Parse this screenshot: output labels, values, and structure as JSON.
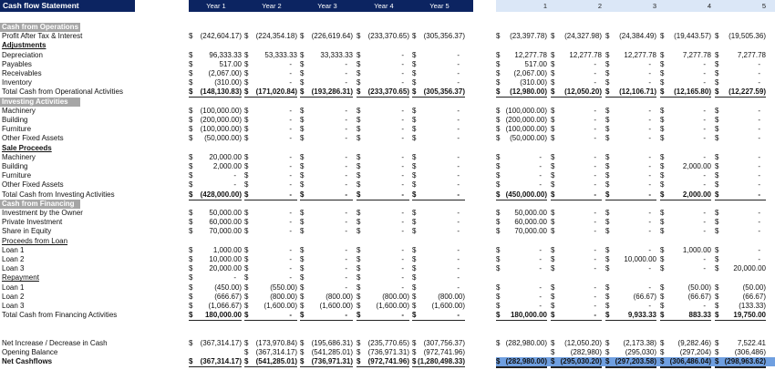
{
  "title": "Cash flow Statement",
  "year_headers": [
    "Year 1",
    "Year 2",
    "Year 3",
    "Year 4",
    "Year 5"
  ],
  "month_headers": [
    "1",
    "2",
    "3",
    "4",
    "5"
  ],
  "currency": "$",
  "colors": {
    "header_navy": "#0c2461",
    "month_header": "#dbe7f7",
    "section_gray": "#a6a6a6",
    "net_highlight": "#6f9fe0"
  },
  "rows": [
    {
      "label": "Cash from Operations",
      "type": "section"
    },
    {
      "label": "Profit After Tax & Interest",
      "type": "line",
      "years": [
        "(242,604.17)",
        "(224,354.18)",
        "(226,619.64)",
        "(233,370.65)",
        "(305,356.37)"
      ],
      "months": [
        "(23,397.78)",
        "(24,327.98)",
        "(24,384.49)",
        "(19,443.57)",
        "(19,505.36)"
      ]
    },
    {
      "label": "Adjustments",
      "type": "heading"
    },
    {
      "label": "Depreciation",
      "type": "line",
      "years": [
        "96,333.33",
        "53,333.33",
        "33,333.33",
        "-",
        "-"
      ],
      "months": [
        "12,277.78",
        "12,277.78",
        "12,277.78",
        "7,277.78",
        "7,277.78"
      ]
    },
    {
      "label": "Payables",
      "type": "line",
      "years": [
        "517.00",
        "-",
        "-",
        "-",
        "-"
      ],
      "months": [
        "517.00",
        "-",
        "-",
        "-",
        "-"
      ]
    },
    {
      "label": "Receivables",
      "type": "line",
      "years": [
        "(2,067.00)",
        "-",
        "-",
        "-",
        "-"
      ],
      "months": [
        "(2,067.00)",
        "-",
        "-",
        "-",
        "-"
      ]
    },
    {
      "label": "Inventory",
      "type": "line",
      "years": [
        "(310.00)",
        "-",
        "-",
        "-",
        "-"
      ],
      "months": [
        "(310.00)",
        "-",
        "-",
        "-",
        "-"
      ]
    },
    {
      "label": "Total Cash from Operational Activities",
      "type": "total",
      "years": [
        "(148,130.83)",
        "(171,020.84)",
        "(193,286.31)",
        "(233,370.65)",
        "(305,356.37)"
      ],
      "months": [
        "(12,980.00)",
        "(12,050.20)",
        "(12,106.71)",
        "(12,165.80)",
        "(12,227.59)"
      ]
    },
    {
      "label": "Investing Activities",
      "type": "section"
    },
    {
      "label": "Machinery",
      "type": "line",
      "years": [
        "(100,000.00)",
        "-",
        "-",
        "-",
        "-"
      ],
      "months": [
        "(100,000.00)",
        "-",
        "-",
        "-",
        "-"
      ]
    },
    {
      "label": "Building",
      "type": "line",
      "years": [
        "(200,000.00)",
        "-",
        "-",
        "-",
        "-"
      ],
      "months": [
        "(200,000.00)",
        "-",
        "-",
        "-",
        "-"
      ]
    },
    {
      "label": "Furniture",
      "type": "line",
      "years": [
        "(100,000.00)",
        "-",
        "-",
        "-",
        "-"
      ],
      "months": [
        "(100,000.00)",
        "-",
        "-",
        "-",
        "-"
      ]
    },
    {
      "label": "Other Fixed Assets",
      "type": "line",
      "years": [
        "(50,000.00)",
        "-",
        "-",
        "-",
        "-"
      ],
      "months": [
        "(50,000.00)",
        "-",
        "-",
        "-",
        "-"
      ]
    },
    {
      "label": "Sale Proceeds",
      "type": "heading"
    },
    {
      "label": "Machinery",
      "type": "line",
      "years": [
        "20,000.00",
        "-",
        "-",
        "-",
        "-"
      ],
      "months": [
        "-",
        "-",
        "-",
        "-",
        "-"
      ]
    },
    {
      "label": "Building",
      "type": "line",
      "years": [
        "2,000.00",
        "-",
        "-",
        "-",
        "-"
      ],
      "months": [
        "-",
        "-",
        "-",
        "2,000.00",
        "-"
      ]
    },
    {
      "label": "Furniture",
      "type": "line",
      "years": [
        "-",
        "-",
        "-",
        "-",
        "-"
      ],
      "months": [
        "-",
        "-",
        "-",
        "-",
        "-"
      ]
    },
    {
      "label": "Other Fixed Assets",
      "type": "line",
      "years": [
        "-",
        "-",
        "-",
        "-",
        "-"
      ],
      "months": [
        "-",
        "-",
        "-",
        "-",
        "-"
      ]
    },
    {
      "label": "Total Cash from Investing Activities",
      "type": "total",
      "years": [
        "(428,000.00)",
        "-",
        "-",
        "-",
        "-"
      ],
      "months": [
        "(450,000.00)",
        "-",
        "-",
        "2,000.00",
        "-"
      ]
    },
    {
      "label": "Cash from Financing",
      "type": "section"
    },
    {
      "label": "Investment by the Owner",
      "type": "line",
      "years": [
        "50,000.00",
        "-",
        "-",
        "-",
        "-"
      ],
      "months": [
        "50,000.00",
        "-",
        "-",
        "-",
        "-"
      ]
    },
    {
      "label": "Private Investment",
      "type": "line",
      "years": [
        "60,000.00",
        "-",
        "-",
        "-",
        "-"
      ],
      "months": [
        "60,000.00",
        "-",
        "-",
        "-",
        "-"
      ]
    },
    {
      "label": "Share in Equity",
      "type": "line",
      "years": [
        "70,000.00",
        "-",
        "-",
        "-",
        "-"
      ],
      "months": [
        "70,000.00",
        "-",
        "-",
        "-",
        "-"
      ]
    },
    {
      "label": "Proceeds from Loan",
      "type": "subheading"
    },
    {
      "label": "Loan 1",
      "type": "line",
      "years": [
        "1,000.00",
        "-",
        "-",
        "-",
        "-"
      ],
      "months": [
        "-",
        "-",
        "-",
        "1,000.00",
        "-"
      ]
    },
    {
      "label": "Loan 2",
      "type": "line",
      "years": [
        "10,000.00",
        "-",
        "-",
        "-",
        "-"
      ],
      "months": [
        "-",
        "-",
        "10,000.00",
        "-",
        "-"
      ]
    },
    {
      "label": "Loan 3",
      "type": "line",
      "years": [
        "20,000.00",
        "-",
        "-",
        "-",
        "-"
      ],
      "months": [
        "-",
        "-",
        "-",
        "-",
        "20,000.00"
      ]
    },
    {
      "label": "Repayment",
      "type": "subheading",
      "years": [
        "-",
        "-",
        "-",
        "-",
        "-"
      ]
    },
    {
      "label": "Loan 1",
      "type": "line",
      "years": [
        "(450.00)",
        "(550.00)",
        "-",
        "-",
        "-"
      ],
      "months": [
        "-",
        "-",
        "-",
        "(50.00)",
        "(50.00)"
      ]
    },
    {
      "label": "Loan 2",
      "type": "line",
      "years": [
        "(666.67)",
        "(800.00)",
        "(800.00)",
        "(800.00)",
        "(800.00)"
      ],
      "months": [
        "-",
        "-",
        "(66.67)",
        "(66.67)",
        "(66.67)"
      ]
    },
    {
      "label": "Loan 3",
      "type": "line",
      "years": [
        "(1,066.67)",
        "(1,600.00)",
        "(1,600.00)",
        "(1,600.00)",
        "(1,600.00)"
      ],
      "months": [
        "-",
        "-",
        "-",
        "-",
        "(133.33)"
      ]
    },
    {
      "label": "Total Cash from Financing Activities",
      "type": "total",
      "years": [
        "180,000.00",
        "-",
        "-",
        "-",
        "-"
      ],
      "months": [
        "180,000.00",
        "-",
        "9,933.33",
        "883.33",
        "19,750.00"
      ]
    },
    {
      "label": "",
      "type": "blank"
    },
    {
      "label": "",
      "type": "blank"
    },
    {
      "label": "Net Increase / Decrease in Cash",
      "type": "line",
      "years": [
        "(367,314.17)",
        "(173,970.84)",
        "(195,686.31)",
        "(235,770.65)",
        "(307,756.37)"
      ],
      "months": [
        "(282,980.00)",
        "(12,050.20)",
        "(2,173.38)",
        "(9,282.46)",
        "7,522.41"
      ]
    },
    {
      "label": "Opening Balance",
      "type": "line",
      "years": [
        null,
        "(367,314.17)",
        "(541,285.01)",
        "(736,971.31)",
        "(972,741.96)"
      ],
      "months": [
        null,
        "(282,980)",
        "(295,030)",
        "(297,204)",
        "(306,486)"
      ]
    },
    {
      "label": "Net Cashflows",
      "type": "net",
      "years": [
        "(367,314.17)",
        "(541,285.01)",
        "(736,971.31)",
        "(972,741.96)",
        "(1,280,498.33)"
      ],
      "months": [
        "(282,980.00)",
        "(295,030.20)",
        "(297,203.58)",
        "(306,486.04)",
        "(298,963.62)"
      ]
    }
  ]
}
